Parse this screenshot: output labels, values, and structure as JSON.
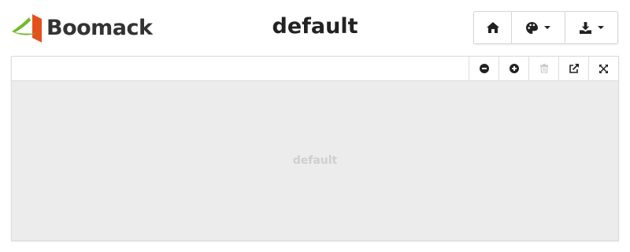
{
  "app": {
    "name": "Boomack",
    "page_title": "default"
  },
  "header": {
    "buttons": [
      {
        "name": "home",
        "icon": "home-icon"
      },
      {
        "name": "theme",
        "icon": "palette-icon",
        "dropdown": true
      },
      {
        "name": "download",
        "icon": "download-icon",
        "dropdown": true
      }
    ]
  },
  "panel": {
    "placeholder": "default",
    "tools": [
      {
        "name": "zoom-out",
        "icon": "minus-circle-icon",
        "enabled": true
      },
      {
        "name": "zoom-in",
        "icon": "plus-circle-icon",
        "enabled": true
      },
      {
        "name": "clear",
        "icon": "trash-icon",
        "enabled": false
      },
      {
        "name": "open-external",
        "icon": "external-link-icon",
        "enabled": true
      },
      {
        "name": "fullscreen",
        "icon": "expand-icon",
        "enabled": true
      }
    ]
  },
  "colors": {
    "logo_green": "#76b82a",
    "logo_red": "#e4501d",
    "panel_bg": "#ececec",
    "icon": "#222222",
    "icon_disabled": "#c8c8c8"
  }
}
